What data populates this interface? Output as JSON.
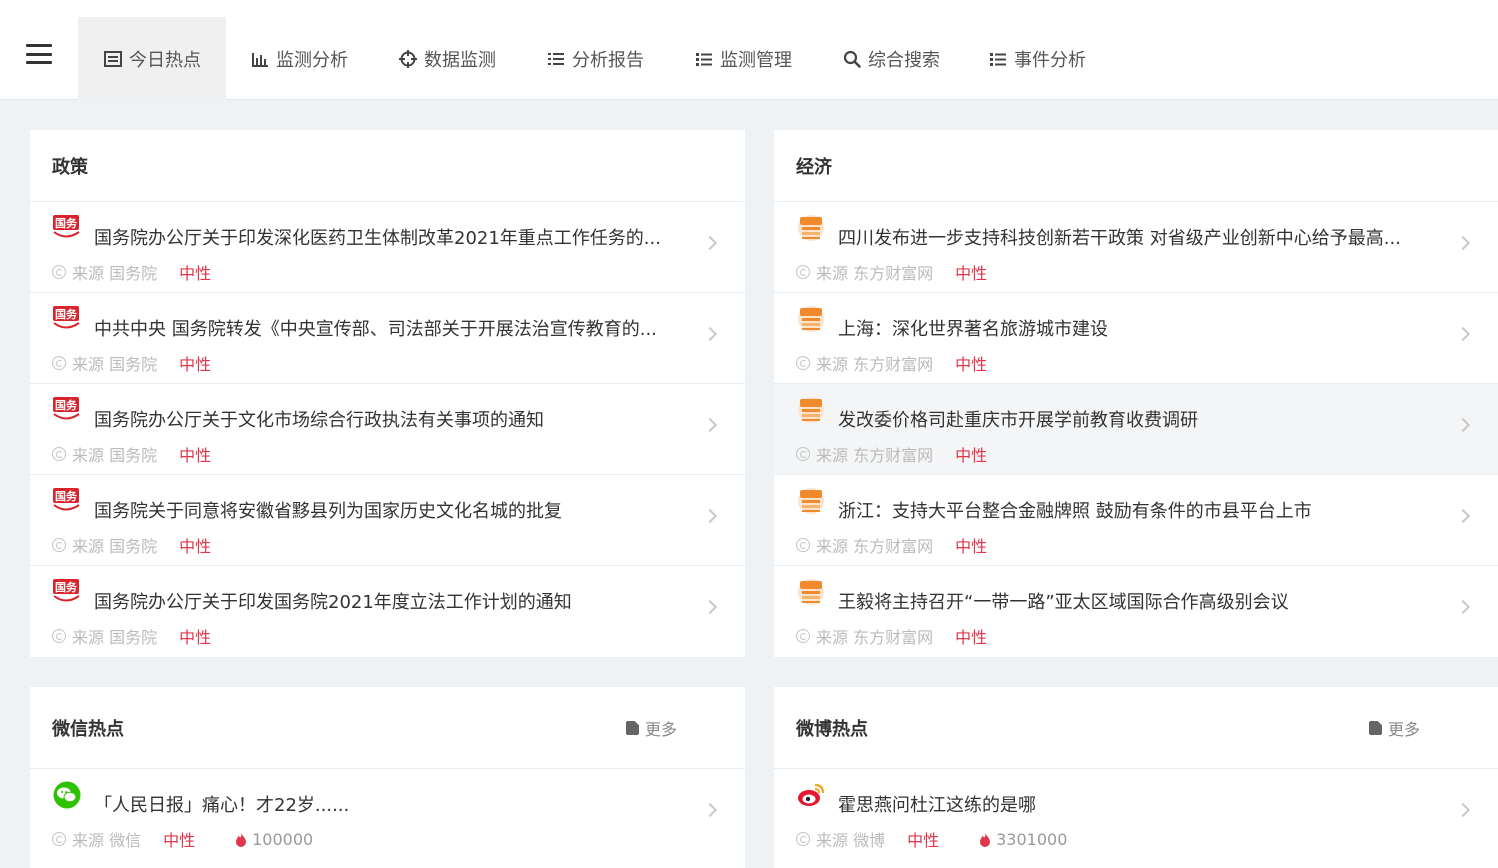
{
  "nav": {
    "tabs": [
      {
        "label": "今日热点",
        "icon": "calendar-list-icon"
      },
      {
        "label": "监测分析",
        "icon": "bar-chart-icon"
      },
      {
        "label": "数据监测",
        "icon": "crosshair-icon"
      },
      {
        "label": "分析报告",
        "icon": "list-ordered-icon"
      },
      {
        "label": "监测管理",
        "icon": "list-icon"
      },
      {
        "label": "综合搜索",
        "icon": "search-icon"
      },
      {
        "label": "事件分析",
        "icon": "list-icon"
      }
    ],
    "active_tab": "今日热点"
  },
  "policy": {
    "title": "政策",
    "items": [
      {
        "title": "国务院办公厅关于印发深化医药卫生体制改革2021年重点工作任务的...",
        "source": "来源 国务院",
        "sentiment": "中性"
      },
      {
        "title": "中共中央 国务院转发《中央宣传部、司法部关于开展法治宣传教育的...",
        "source": "来源 国务院",
        "sentiment": "中性"
      },
      {
        "title": "国务院办公厅关于文化市场综合行政执法有关事项的通知",
        "source": "来源 国务院",
        "sentiment": "中性"
      },
      {
        "title": "国务院关于同意将安徽省黟县列为国家历史文化名城的批复",
        "source": "来源 国务院",
        "sentiment": "中性"
      },
      {
        "title": "国务院办公厅关于印发国务院2021年度立法工作计划的通知",
        "source": "来源 国务院",
        "sentiment": "中性"
      }
    ]
  },
  "economy": {
    "title": "经济",
    "items": [
      {
        "title": "四川发布进一步支持科技创新若干政策 对省级产业创新中心给予最高...",
        "source": "来源 东方财富网",
        "sentiment": "中性"
      },
      {
        "title": "上海：深化世界著名旅游城市建设",
        "source": "来源 东方财富网",
        "sentiment": "中性"
      },
      {
        "title": "发改委价格司赴重庆市开展学前教育收费调研",
        "source": "来源 东方财富网",
        "sentiment": "中性"
      },
      {
        "title": "浙江：支持大平台整合金融牌照 鼓励有条件的市县平台上市",
        "source": "来源 东方财富网",
        "sentiment": "中性"
      },
      {
        "title": "王毅将主持召开“一带一路”亚太区域国际合作高级别会议",
        "source": "来源 东方财富网",
        "sentiment": "中性"
      }
    ]
  },
  "wechat": {
    "title": "微信热点",
    "more": "更多",
    "items": [
      {
        "title": "「人民日报」痛心！才22岁......",
        "source": "来源 微信",
        "sentiment": "中性",
        "heat": "100000"
      }
    ]
  },
  "weibo": {
    "title": "微博热点",
    "more": "更多",
    "items": [
      {
        "title": "霍思燕问杜江这练的是哪",
        "source": "来源 微博",
        "sentiment": "中性",
        "heat": "3301000"
      }
    ]
  },
  "colors": {
    "sentiment": "#e0374c",
    "govt_icon": "#d9232d",
    "eastmoney_icon": "#f08a2c",
    "wechat_icon": "#2dc100",
    "weibo_icon": "#e6162d"
  }
}
